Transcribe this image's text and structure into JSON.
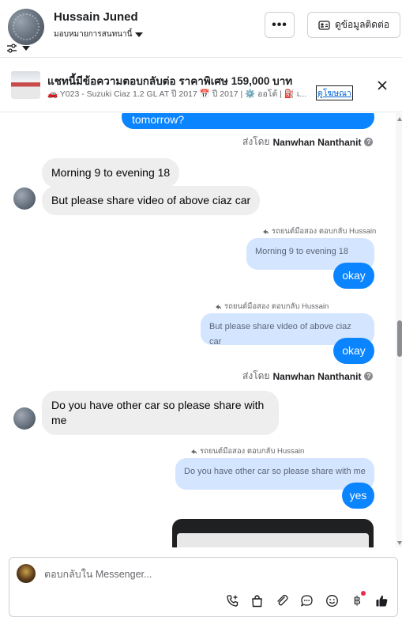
{
  "header": {
    "contact_name": "Hussain Juned",
    "assign_label": "มอบหมายการสนทนานี้",
    "more_label": "•••",
    "contact_info_label": "ดูข้อมูลติดต่อ"
  },
  "ad_banner": {
    "title": "แชทนี้มีข้อความตอบกลับต่อ ราคาพิเศษ 159,000 บาท",
    "subtitle": "🚗 Y023 - Suzuki Ciaz 1.2 GL AT ปี 2017 📅 ปี 2017 | ⚙️ ออโต้ | ⛽ เ...",
    "link_label": "ดูโฆษณา"
  },
  "messages": {
    "m0": "tomorrow?",
    "sent_by_prefix": "ส่งโดย",
    "sender_name": "Nanwhan Nanthanit",
    "m1": "Morning 9 to evening 18",
    "m2": "But please share video of above ciaz car",
    "reply_label_1": "รถยนต์มือสอง ตอบกลับ Hussain",
    "quoted_1": "Morning 9 to evening 18",
    "m3": "okay",
    "reply_label_2": "รถยนต์มือสอง ตอบกลับ Hussain",
    "quoted_2": "But please share video of above ciaz car",
    "m4": "okay",
    "m5": "Do you have other car so please share with me",
    "reply_label_3": "รถยนต์มือสอง ตอบกลับ Hussain",
    "quoted_3": "Do you have other car so please share with me",
    "m6": "yes"
  },
  "composer": {
    "placeholder": "ตอบกลับใน Messenger..."
  },
  "colors": {
    "outgoing_bubble": "#0a84ff",
    "incoming_bubble": "#eeeeee",
    "quoted_bubble": "#d4e5ff",
    "accent_red": "#f02849"
  },
  "icons": [
    "filter-icon",
    "chevron-down-icon",
    "more-icon",
    "contact-card-icon",
    "close-icon",
    "info-icon",
    "reply-arrow-icon",
    "add-call-icon",
    "shopping-bag-icon",
    "attachment-icon",
    "chat-bubble-icon",
    "emoji-icon",
    "baht-icon",
    "thumbs-up-icon"
  ]
}
